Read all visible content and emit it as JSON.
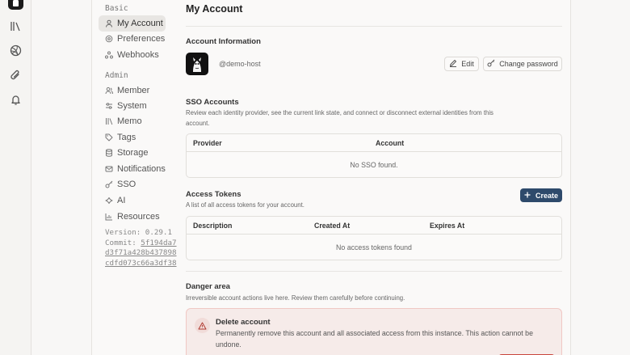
{
  "nav": {
    "basic_label": "Basic",
    "basic_items": [
      {
        "label": "My Account",
        "icon": "user-icon"
      },
      {
        "label": "Preferences",
        "icon": "cog-icon"
      },
      {
        "label": "Webhooks",
        "icon": "webhook-icon"
      }
    ],
    "admin_label": "Admin",
    "admin_items": [
      {
        "label": "Member",
        "icon": "users-icon"
      },
      {
        "label": "System",
        "icon": "settings-icon"
      },
      {
        "label": "Memo",
        "icon": "library-icon"
      },
      {
        "label": "Tags",
        "icon": "tag-icon"
      },
      {
        "label": "Storage",
        "icon": "database-icon"
      },
      {
        "label": "Notifications",
        "icon": "mail-icon"
      },
      {
        "label": "SSO",
        "icon": "key-icon"
      },
      {
        "label": "AI",
        "icon": "sparkle-icon"
      },
      {
        "label": "Resources",
        "icon": "chart-icon"
      }
    ],
    "version_label": "Version: 0.29.1",
    "commit_label": "Commit:",
    "commit_hash_1": "5f194da7",
    "commit_hash_2": "d3f71a428b437898",
    "commit_hash_3": "cdfd073c66a3df38"
  },
  "page": {
    "title": "My Account",
    "account_info_title": "Account Information",
    "handle": "@demo-host",
    "edit_label": "Edit",
    "change_password_label": "Change password",
    "sso_title": "SSO Accounts",
    "sso_desc": "Review each identity provider, see the current link state, and connect or disconnect external identities from this account.",
    "sso_col_provider": "Provider",
    "sso_col_account": "Account",
    "sso_empty": "No SSO found.",
    "tokens_title": "Access Tokens",
    "tokens_desc": "A list of all access tokens for your account.",
    "create_label": "Create",
    "tokens_col_description": "Description",
    "tokens_col_created": "Created At",
    "tokens_col_expires": "Expires At",
    "tokens_empty": "No access tokens found",
    "danger_title": "Danger area",
    "danger_desc": "Irreversible account actions live here. Review them carefully before continuing.",
    "delete_title": "Delete account",
    "delete_desc": "Permanently remove this account and all associated access from this instance. This action cannot be undone."
  },
  "colors": {
    "primary": "#2e4a6b",
    "danger": "#c9453c"
  }
}
